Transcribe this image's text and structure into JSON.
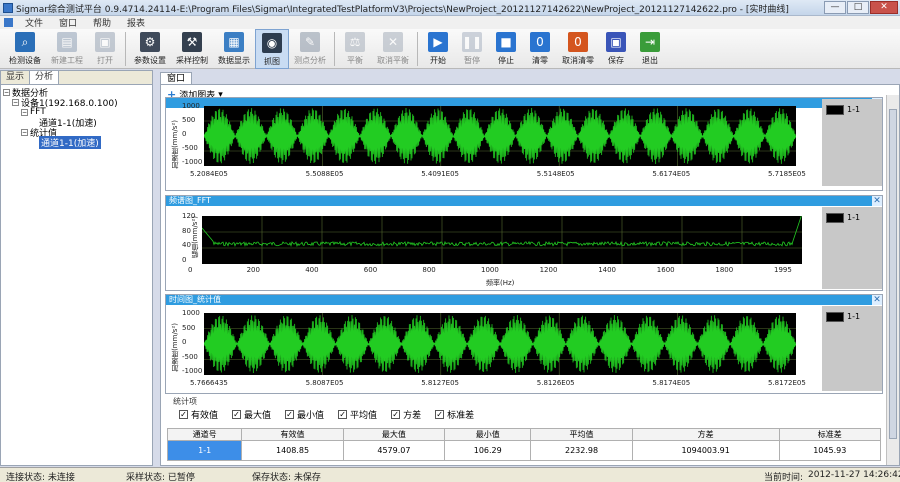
{
  "window": {
    "title": "Sigmar综合测试平台 0.9.4714.24114-E:\\Program Files\\Sigmar\\IntegratedTestPlatformV3\\Projects\\NewProject_20121127142622\\NewProject_20121127142622.pro - [实时曲线]",
    "min": "—",
    "max": "□",
    "close": "✕"
  },
  "menu": [
    "文件",
    "窗口",
    "帮助",
    "报表"
  ],
  "toolbar": [
    {
      "label": "检测设备",
      "icon": "device-search-icon",
      "color": "#2b6fb8",
      "glyph": "⌕",
      "disabled": false
    },
    {
      "label": "新建工程",
      "icon": "new-project-icon",
      "color": "#8fa0b5",
      "glyph": "▤",
      "disabled": true
    },
    {
      "label": "打开",
      "icon": "open-icon",
      "color": "#9aa6b6",
      "glyph": "▣",
      "disabled": true
    },
    {
      "label": "参数设置",
      "icon": "param-settings-icon",
      "color": "#3f4a5a",
      "glyph": "⚙",
      "disabled": false
    },
    {
      "label": "采样控制",
      "icon": "sampling-control-icon",
      "color": "#34404f",
      "glyph": "⚒",
      "disabled": false
    },
    {
      "label": "数据显示",
      "icon": "data-display-icon",
      "color": "#3c7fc4",
      "glyph": "▦",
      "disabled": false
    },
    {
      "label": "抓图",
      "icon": "capture-icon",
      "color": "#2d3c4f",
      "glyph": "◉",
      "disabled": false
    },
    {
      "label": "测点分析",
      "icon": "point-analysis-icon",
      "color": "#8a96a6",
      "glyph": "✎",
      "disabled": true
    },
    {
      "label": "平衡",
      "icon": "balance-icon",
      "color": "#a6afbb",
      "glyph": "⚖",
      "disabled": true
    },
    {
      "label": "取消平衡",
      "icon": "cancel-balance-icon",
      "color": "#a6afbb",
      "glyph": "✕",
      "disabled": true
    },
    {
      "label": "开始",
      "icon": "start-icon",
      "color": "#2a74d0",
      "glyph": "▶",
      "disabled": false
    },
    {
      "label": "暂停",
      "icon": "pause-icon",
      "color": "#a9b3c2",
      "glyph": "❚❚",
      "disabled": true
    },
    {
      "label": "停止",
      "icon": "stop-icon",
      "color": "#2a74d0",
      "glyph": "■",
      "disabled": false
    },
    {
      "label": "清零",
      "icon": "zero-icon",
      "color": "#2a74d0",
      "glyph": "0",
      "disabled": false
    },
    {
      "label": "取消清零",
      "icon": "cancel-zero-icon",
      "color": "#d4551e",
      "glyph": "0",
      "disabled": false
    },
    {
      "label": "保存",
      "icon": "save-icon",
      "color": "#3a55b8",
      "glyph": "▣",
      "disabled": false
    },
    {
      "label": "退出",
      "icon": "exit-icon",
      "color": "#3a9c3a",
      "glyph": "⇥",
      "disabled": false
    }
  ],
  "left_tabs": [
    "显示",
    "分析"
  ],
  "tree": [
    {
      "label": "数据分析",
      "level": 0,
      "toggle": "−"
    },
    {
      "label": "设备1(192.168.0.100)",
      "level": 1,
      "toggle": "−"
    },
    {
      "label": "FFT",
      "level": 2,
      "toggle": "−"
    },
    {
      "label": "通道1-1(加速)",
      "level": 3,
      "toggle": ""
    },
    {
      "label": "统计值",
      "level": 2,
      "toggle": "−"
    },
    {
      "label": "通道1-1(加速)",
      "level": 3,
      "toggle": "",
      "selected": true
    }
  ],
  "doc_tab": "窗口",
  "add_chart": "添加图表",
  "chart1": {
    "legend": "1-1",
    "ylabel": "加速度(mm/s²)",
    "yticks": [
      "1000",
      "500",
      "0",
      "-500",
      "-1000"
    ],
    "xticks": [
      "5.2084E05",
      "5.5088E05",
      "5.4091E05",
      "5.5148E05",
      "5.6174E05",
      "5.7185E05"
    ]
  },
  "chart2": {
    "title": "频谱图_FFT",
    "legend": "1-1",
    "ylabel": "幅值(mm/s²)",
    "xlabel": "频率(Hz)",
    "yticks": [
      "120",
      "80",
      "40",
      "0"
    ],
    "xticks": [
      "0",
      "200",
      "400",
      "600",
      "800",
      "1000",
      "1200",
      "1400",
      "1600",
      "1800",
      "1995"
    ]
  },
  "chart3": {
    "title": "时间图_统计值",
    "legend": "1-1",
    "ylabel": "加速度(mm/s²)",
    "yticks": [
      "1000",
      "500",
      "0",
      "-500",
      "-1000"
    ],
    "xticks": [
      "5.7666435",
      "5.8087E05",
      "5.8127E05",
      "5.8126E05",
      "5.8174E05",
      "5.8172E05"
    ]
  },
  "stats": {
    "group_title": "统计项",
    "checkboxes": [
      "有效值",
      "最大值",
      "最小值",
      "平均值",
      "方差",
      "标准差"
    ],
    "columns": [
      "通道号",
      "有效值",
      "最大值",
      "最小值",
      "平均值",
      "方差",
      "标准差"
    ],
    "row": [
      "1-1",
      "1408.85",
      "4579.07",
      "106.29",
      "2232.98",
      "1094003.91",
      "1045.93"
    ]
  },
  "status": {
    "connect": "连接状态: 未连接",
    "sample": "采样状态: 已暂停",
    "save": "保存状态: 未保存",
    "time_label": "当前时间:",
    "time": "2012-11-27 14:26:42"
  },
  "colors": {
    "signal": "#22cc22",
    "header": "#2f9ce0",
    "plot_bg": "#000000",
    "selected": "#3d8ee8"
  }
}
